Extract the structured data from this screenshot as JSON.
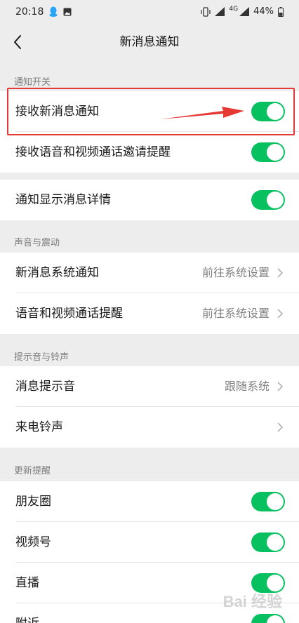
{
  "status_bar": {
    "time": "20:18",
    "network": "4G",
    "battery": "44%",
    "icons": [
      "qq-icon",
      "image-icon",
      "vibrate-icon",
      "signal-icon",
      "battery-icon"
    ]
  },
  "nav": {
    "title": "新消息通知",
    "back_icon": "chevron-left-icon"
  },
  "sections": {
    "notify_switch": {
      "label": "通知开关",
      "rows": [
        {
          "label": "接收新消息通知",
          "toggle_on": true
        },
        {
          "label": "接收语音和视频通话邀请提醒",
          "toggle_on": true
        }
      ]
    },
    "detail": {
      "rows": [
        {
          "label": "通知显示消息详情",
          "toggle_on": true
        }
      ]
    },
    "sound_vibrate": {
      "label": "声音与震动",
      "rows": [
        {
          "label": "新消息系统通知",
          "value": "前往系统设置"
        },
        {
          "label": "语音和视频通话提醒",
          "value": "前往系统设置"
        }
      ]
    },
    "tones": {
      "label": "提示音与铃声",
      "rows": [
        {
          "label": "消息提示音",
          "value": "跟随系统"
        },
        {
          "label": "来电铃声",
          "value": ""
        }
      ]
    },
    "updates": {
      "label": "更新提醒",
      "rows": [
        {
          "label": "朋友圈",
          "toggle_on": true
        },
        {
          "label": "视频号",
          "toggle_on": true
        },
        {
          "label": "直播",
          "toggle_on": true
        },
        {
          "label": "附近",
          "toggle_on": true
        }
      ]
    }
  },
  "colors": {
    "toggle_on": "#07c160",
    "highlight": "#e53935",
    "background": "#ededed"
  },
  "watermark": "Bai 经验"
}
